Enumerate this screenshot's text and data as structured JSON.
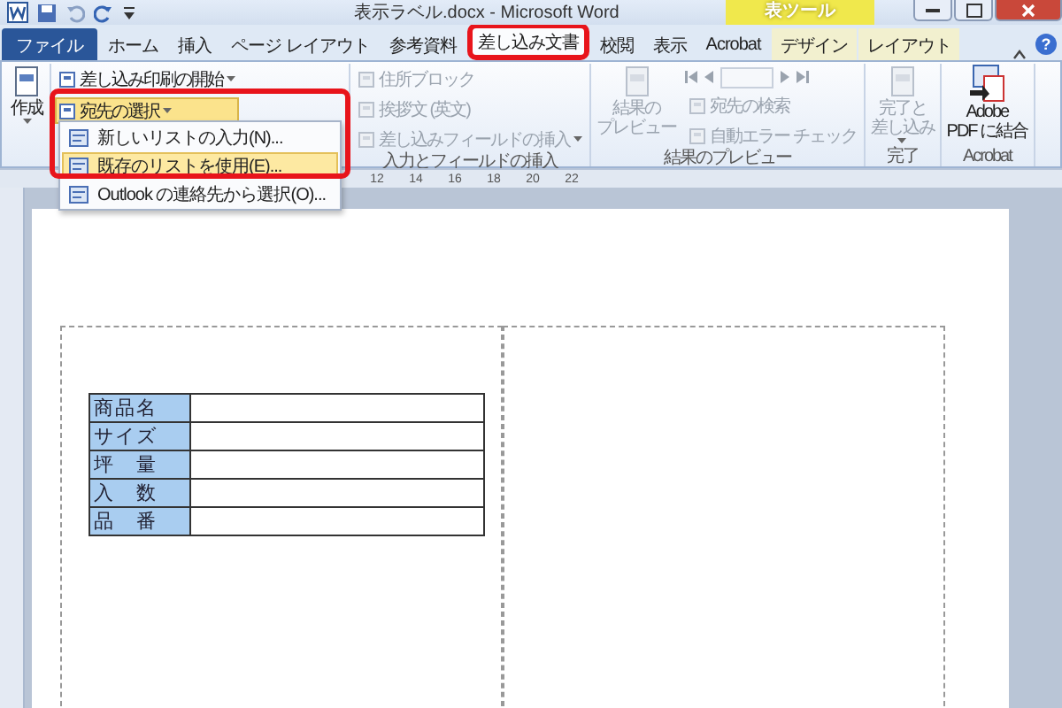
{
  "window": {
    "title": "表示ラベル.docx - Microsoft Word",
    "context_tab_group": "表ツール",
    "help": "?"
  },
  "tabs": [
    {
      "label": "ファイル",
      "kind": "file",
      "selected": false,
      "contextual": false
    },
    {
      "label": "ホーム",
      "kind": "tab",
      "selected": false,
      "contextual": false
    },
    {
      "label": "挿入",
      "kind": "tab",
      "selected": false,
      "contextual": false
    },
    {
      "label": "ページ レイアウト",
      "kind": "tab",
      "selected": false,
      "contextual": false
    },
    {
      "label": "参考資料",
      "kind": "tab",
      "selected": false,
      "contextual": false
    },
    {
      "label": "差し込み文書",
      "kind": "tab",
      "selected": true,
      "contextual": false
    },
    {
      "label": "校閲",
      "kind": "tab",
      "selected": false,
      "contextual": false
    },
    {
      "label": "表示",
      "kind": "tab",
      "selected": false,
      "contextual": false
    },
    {
      "label": "Acrobat",
      "kind": "tab",
      "selected": false,
      "contextual": false
    },
    {
      "label": "デザイン",
      "kind": "tab",
      "selected": false,
      "contextual": true
    },
    {
      "label": "レイアウト",
      "kind": "tab",
      "selected": false,
      "contextual": true
    }
  ],
  "ribbon": [
    {
      "items": [
        {
          "kind": "large",
          "lines": [
            "作成"
          ],
          "dropdown": true,
          "disabled": false
        }
      ]
    },
    {
      "items": [
        {
          "kind": "small",
          "text": "差し込み印刷の開始",
          "dropdown": true,
          "disabled": false,
          "active": false
        },
        {
          "kind": "small",
          "text": "宛先の選択",
          "dropdown": true,
          "disabled": false,
          "active": true
        }
      ]
    },
    {
      "label": "入力とフィールドの挿入",
      "items": [
        {
          "kind": "small",
          "text": "住所ブロック",
          "dropdown": false,
          "disabled": true,
          "active": false
        },
        {
          "kind": "small",
          "text": "挨拶文 (英文)",
          "dropdown": false,
          "disabled": true,
          "active": false
        },
        {
          "kind": "small",
          "text": "差し込みフィールドの挿入",
          "dropdown": true,
          "disabled": true,
          "active": false
        }
      ]
    },
    {
      "label": "結果のプレビュー",
      "items": [
        {
          "kind": "large",
          "lines": [
            "結果の",
            "プレビュー"
          ],
          "dropdown": false,
          "disabled": true
        },
        {
          "kind": "nav",
          "disabled": true
        },
        {
          "kind": "small",
          "text": "宛先の検索",
          "dropdown": false,
          "disabled": true,
          "active": false
        },
        {
          "kind": "small",
          "text": "自動エラー チェック",
          "dropdown": false,
          "disabled": true,
          "active": false
        }
      ]
    },
    {
      "label": "完了",
      "items": [
        {
          "kind": "large",
          "lines": [
            "完了と",
            "差し込み"
          ],
          "dropdown": true,
          "disabled": true
        }
      ]
    },
    {
      "label": "Acrobat",
      "items": [
        {
          "kind": "large",
          "lines": [
            "Adobe",
            "PDF に結合"
          ],
          "dropdown": false,
          "disabled": false
        }
      ]
    }
  ],
  "menu": [
    {
      "label": "新しいリストの入力(N)...",
      "selected": false
    },
    {
      "label": "既存のリストを使用(E)...",
      "selected": true
    },
    {
      "label": "Outlook の連絡先から選択(O)...",
      "selected": false
    }
  ],
  "ruler": [
    "12",
    "14",
    "16",
    "18",
    "20",
    "22"
  ],
  "label_table": [
    {
      "heading": "商品名"
    },
    {
      "heading": "サイズ"
    },
    {
      "heading": "坪　量"
    },
    {
      "heading": "入　数"
    },
    {
      "heading": "品　番"
    }
  ]
}
